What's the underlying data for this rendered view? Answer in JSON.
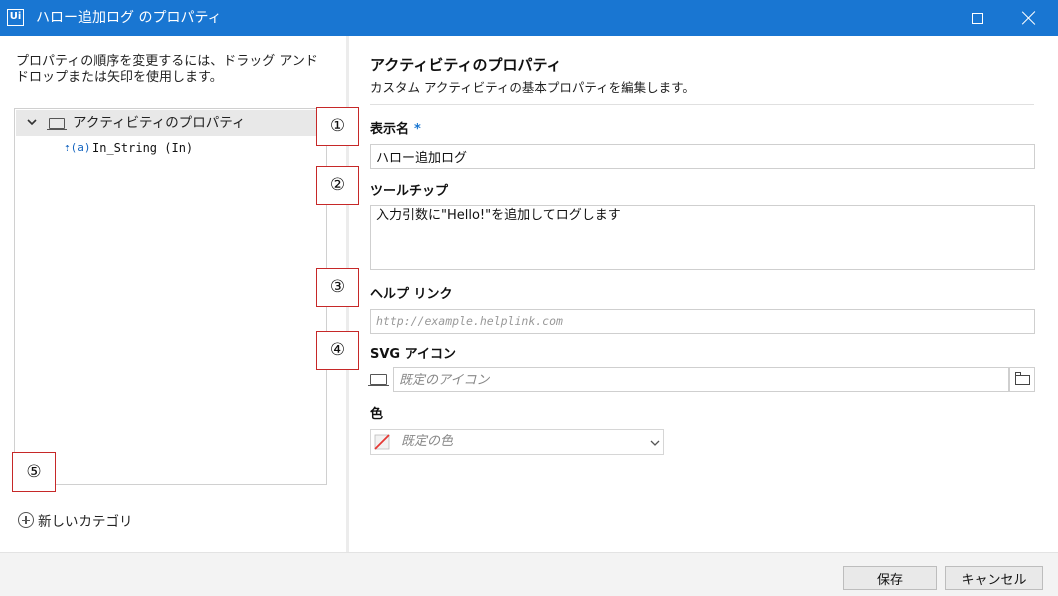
{
  "window": {
    "app_icon_text": "Ui",
    "title": "ハロー追加ログ のプロパティ"
  },
  "left": {
    "instructions": "プロパティの順序を変更するには、ドラッグ アンド ドロップまたは矢印を使用します。",
    "tree": {
      "category_label": "アクティビティのプロパティ",
      "argument_icon_text": "⇡(a)",
      "argument_label": "In_String (In)"
    },
    "new_category_label": "新しいカテゴリ"
  },
  "right": {
    "title": "アクティビティのプロパティ",
    "subtitle": "カスタム アクティビティの基本プロパティを編集します。",
    "display_name": {
      "label": "表示名",
      "required_mark": "*",
      "value": "ハロー追加ログ"
    },
    "tooltip": {
      "label": "ツールチップ",
      "value": "入力引数に\"Hello!\"を追加してログします"
    },
    "help_link": {
      "label": "ヘルプ リンク",
      "placeholder": "http://example.helplink.com"
    },
    "svg_icon": {
      "label": "SVG アイコン",
      "placeholder": "既定のアイコン"
    },
    "color": {
      "label": "色",
      "selected": "既定の色"
    }
  },
  "callouts": [
    "①",
    "②",
    "③",
    "④",
    "⑤"
  ],
  "footer": {
    "save_label": "保存",
    "cancel_label": "キャンセル"
  },
  "colors": {
    "title_bar": "#1976d2",
    "required_mark": "#1976d2",
    "callout_border": "#c62828"
  },
  "icons": [
    "app-icon",
    "maximize-icon",
    "close-icon",
    "chevron-down-icon",
    "category-icon",
    "argument-in-icon",
    "plus-circle-icon",
    "svg-icon-preview",
    "folder-icon",
    "color-none-icon"
  ]
}
